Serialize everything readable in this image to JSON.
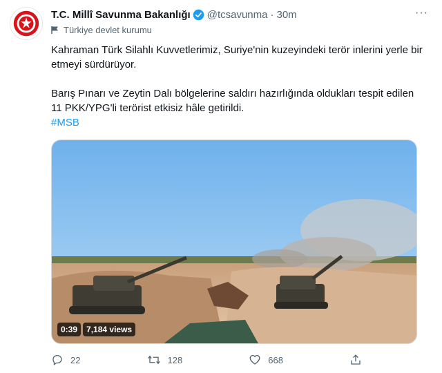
{
  "tweet": {
    "display_name": "T.C. Millî Savunma Bakanlığı",
    "handle": "@tcsavunma",
    "separator": "·",
    "time": "30m",
    "more": "···",
    "account_label": "Türkiye devlet kurumu",
    "paragraph1": "Kahraman Türk Silahlı Kuvvetlerimiz, Suriye'nin kuzeyindeki terör inlerini yerle bir etmeyi sürdürüyor.",
    "paragraph2": "Barış Pınarı ve Zeytin Dalı bölgelerine saldırı hazırlığında oldukları tespit edilen 11 PKK/YPG'li terörist etkisiz hâle getirildi.",
    "hashtag": "#MSB",
    "verified_color": "#1d9bf0",
    "avatar_color": "#d7141a"
  },
  "video": {
    "duration": "0:39",
    "views": "7,184 views"
  },
  "actions": {
    "replies": "22",
    "retweets": "128",
    "likes": "668"
  }
}
